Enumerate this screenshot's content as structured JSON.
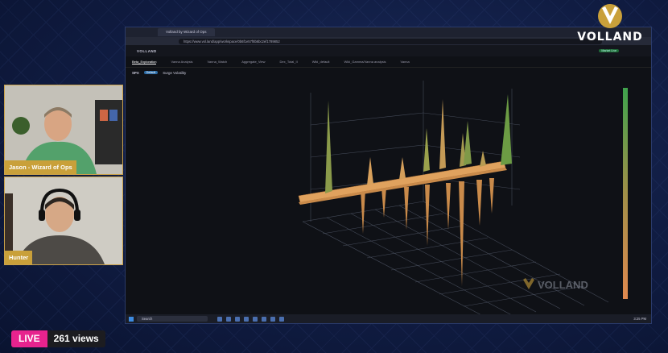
{
  "stream": {
    "live_label": "LIVE",
    "views_label": "261 views",
    "participants": [
      {
        "name": "Jason - Wizard of Ops"
      },
      {
        "name": "Hunter"
      }
    ],
    "brand": "VOLLAND",
    "brand_color": "#c9a03a",
    "live_color": "#e7238e"
  },
  "browser": {
    "tab_title": "Volland by Wizard of Ops",
    "url": "https://www.vol.land/app/workspace/0b6f1e57f8b6bc2ef1789852"
  },
  "app": {
    "name": "VOLLAND",
    "tabs": [
      "Beta_Exploration",
      "Vanna Analysis",
      "Vanna_Watch",
      "Aggregate_View",
      "Dex_Total_II",
      "Wiki_default",
      "Wiki_Gamma/Vanna analysis",
      "Vanna"
    ],
    "active_tab": 0,
    "ticker": "SPX",
    "ticker_badge": "Default",
    "mode_label": "Surge Volatility",
    "status_badge": "Market Live",
    "watermark": "VOLLAND"
  },
  "taskbar": {
    "search_placeholder": "Search",
    "clock": "3:25 PM"
  },
  "colors": {
    "surface": "#e0a25e",
    "colorbar_top": "#3fa34d",
    "colorbar_bottom": "#e0894f"
  }
}
